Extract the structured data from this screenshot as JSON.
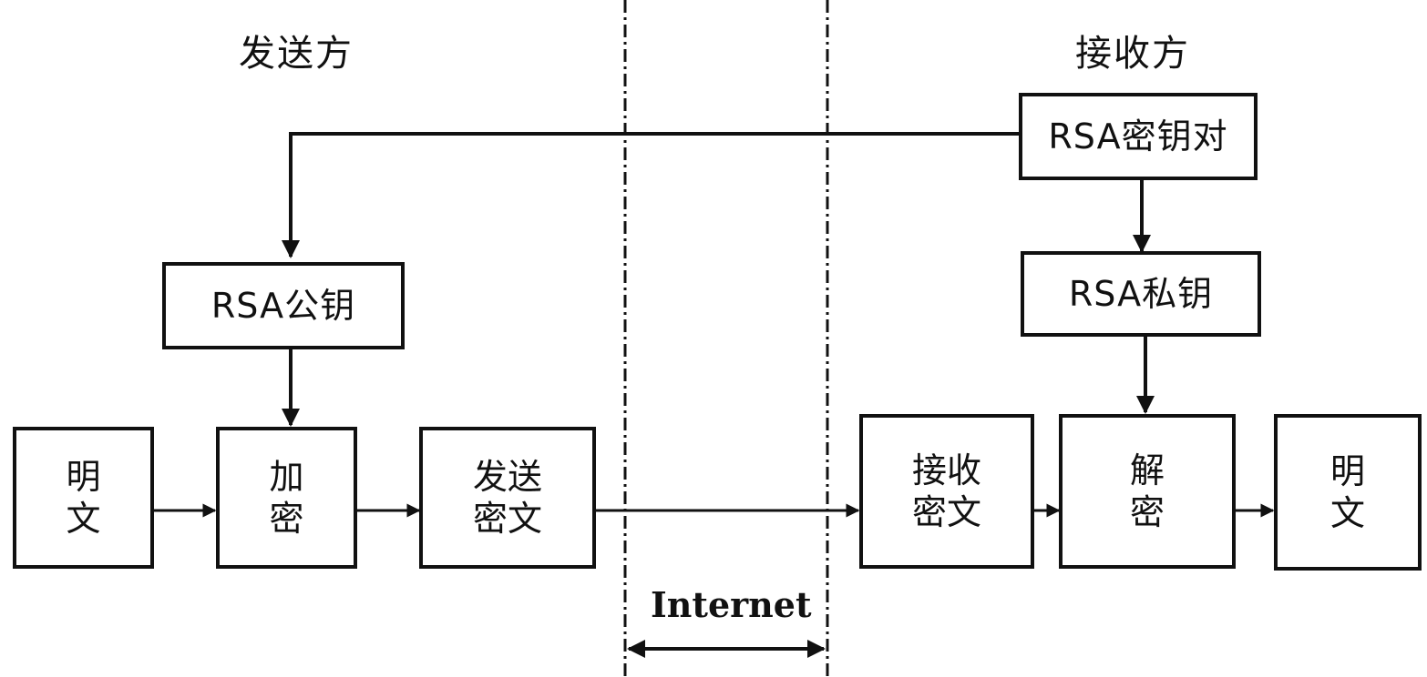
{
  "headings": {
    "sender": "发送方",
    "receiver": "接收方"
  },
  "boxes": {
    "key_pair": "RSA密钥对",
    "public_key": "RSA公钥",
    "private_key": "RSA私钥",
    "plaintext_in": [
      "明",
      "文"
    ],
    "encrypt": [
      "加",
      "密"
    ],
    "send_ciphertext": [
      "发送",
      "密文"
    ],
    "receive_ciphertext": [
      "接收",
      "密文"
    ],
    "decrypt": [
      "解",
      "密"
    ],
    "plaintext_out": [
      "明",
      "文"
    ]
  },
  "network_label": "Internet",
  "colors": {
    "line": "#111111",
    "background": "#ffffff"
  }
}
